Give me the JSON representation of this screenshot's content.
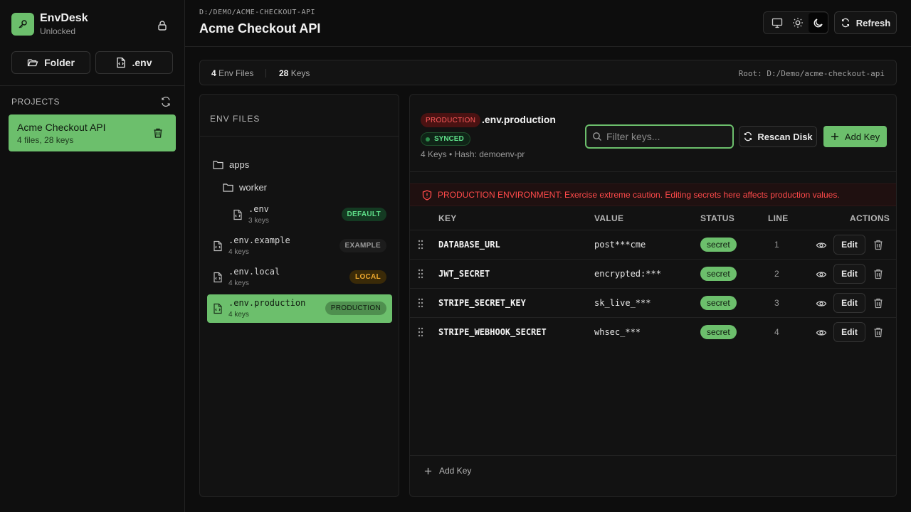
{
  "brand": {
    "name": "EnvDesk",
    "status": "Unlocked"
  },
  "sidebar": {
    "folder_btn": "Folder",
    "env_btn": ".env",
    "projects_label": "PROJECTS",
    "project": {
      "name": "Acme Checkout API",
      "meta": "4 files, 28 keys"
    }
  },
  "header": {
    "breadcrumb": "D:/DEMO/ACME-CHECKOUT-API",
    "title": "Acme Checkout API",
    "refresh_label": "Refresh"
  },
  "stats": {
    "env_files_count": "4",
    "env_files_label": "Env Files",
    "keys_count": "28",
    "keys_label": "Keys",
    "root": "Root: D:/Demo/acme-checkout-api"
  },
  "files_panel": {
    "title": "ENV FILES",
    "folders": [
      "apps",
      "worker"
    ],
    "files": [
      {
        "name": ".env",
        "keys": "3 keys",
        "badge": "DEFAULT"
      },
      {
        "name": ".env.example",
        "keys": "4 keys",
        "badge": "EXAMPLE"
      },
      {
        "name": ".env.local",
        "keys": "4 keys",
        "badge": "LOCAL"
      },
      {
        "name": ".env.production",
        "keys": "4 keys",
        "badge": "PRODUCTION"
      }
    ]
  },
  "main": {
    "env_tag": "PRODUCTION",
    "file_title": ".env.production",
    "synced": "SYNCED",
    "meta": "4 Keys • Hash: demoenv-pr",
    "filter_placeholder": "Filter keys...",
    "rescan_label": "Rescan Disk",
    "add_key_label": "Add Key",
    "warning": "PRODUCTION ENVIRONMENT: Exercise extreme caution. Editing secrets here affects production values.",
    "columns": [
      "KEY",
      "VALUE",
      "STATUS",
      "LINE",
      "ACTIONS"
    ],
    "rows": [
      {
        "key": "DATABASE_URL",
        "value": "post***cme",
        "status": "secret",
        "line": "1"
      },
      {
        "key": "JWT_SECRET",
        "value": "encrypted:***",
        "status": "secret",
        "line": "2"
      },
      {
        "key": "STRIPE_SECRET_KEY",
        "value": "sk_live_***",
        "status": "secret",
        "line": "3"
      },
      {
        "key": "STRIPE_WEBHOOK_SECRET",
        "value": "whsec_***",
        "status": "secret",
        "line": "4"
      }
    ],
    "edit_label": "Edit",
    "footer_add": "Add Key"
  },
  "colors": {
    "accent": "#6cbf6c",
    "danger": "#ff4a4a",
    "background": "#0d0d0d"
  }
}
